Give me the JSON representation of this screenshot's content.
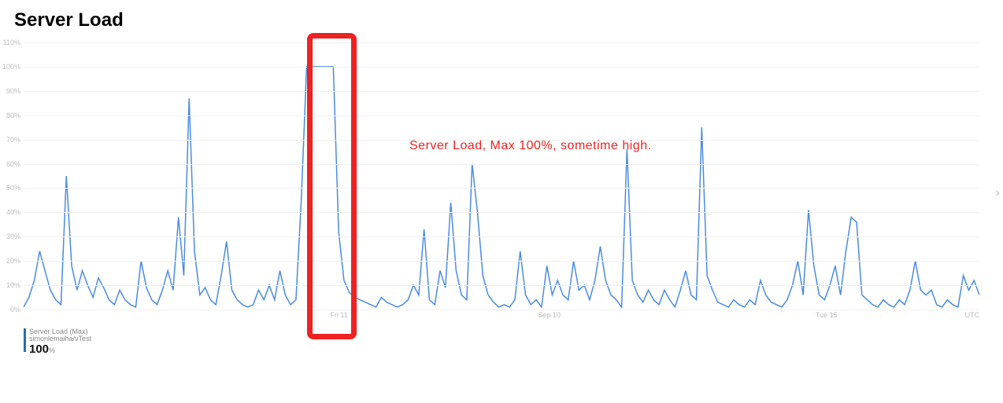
{
  "title": "Server Load",
  "annotation_text": "Server Load,   Max 100%,  sometime high.",
  "x_right_label": "UTC",
  "legend": {
    "line1": "Server Load (Max)",
    "line2": "simonlemaiha/vTest",
    "value": "100",
    "unit": "%"
  },
  "chart_data": {
    "type": "line",
    "title": "Server Load",
    "ylabel": "%",
    "ylim": [
      0,
      110
    ],
    "y_ticks": [
      0,
      10,
      20,
      30,
      40,
      50,
      60,
      70,
      80,
      90,
      100,
      110
    ],
    "x_ticks": [
      {
        "pos": 0.33,
        "label": "Fri 11"
      },
      {
        "pos": 0.55,
        "label": "Sep 10"
      },
      {
        "pos": 0.84,
        "label": "Tue 15"
      }
    ],
    "series": [
      {
        "name": "Server Load (Max)",
        "color": "#4a8bdf",
        "values": [
          1,
          5,
          12,
          24,
          16,
          8,
          4,
          2,
          55,
          18,
          8,
          16,
          10,
          5,
          13,
          9,
          4,
          2,
          8,
          4,
          2,
          1,
          20,
          9,
          4,
          2,
          8,
          16,
          8,
          38,
          14,
          87,
          24,
          6,
          9,
          4,
          2,
          14,
          28,
          8,
          4,
          2,
          1,
          2,
          8,
          4,
          10,
          4,
          16,
          6,
          2,
          4,
          45,
          100,
          100,
          100,
          100,
          100,
          100,
          32,
          12,
          7,
          5,
          4,
          3,
          2,
          1,
          5,
          3,
          2,
          1,
          2,
          4,
          10,
          6,
          33,
          4,
          2,
          16,
          9,
          44,
          16,
          6,
          4,
          60,
          40,
          14,
          6,
          3,
          1,
          2,
          1,
          4,
          24,
          6,
          2,
          4,
          1,
          18,
          6,
          12,
          6,
          4,
          20,
          8,
          10,
          4,
          12,
          26,
          12,
          6,
          4,
          1,
          66,
          12,
          6,
          3,
          8,
          4,
          2,
          8,
          4,
          1,
          8,
          16,
          6,
          4,
          75,
          14,
          8,
          3,
          2,
          1,
          4,
          2,
          1,
          4,
          2,
          12,
          6,
          3,
          2,
          1,
          4,
          10,
          20,
          6,
          41,
          18,
          6,
          4,
          10,
          18,
          6,
          24,
          38,
          36,
          6,
          4,
          2,
          1,
          4,
          2,
          1,
          4,
          2,
          8,
          20,
          8,
          6,
          8,
          2,
          1,
          4,
          2,
          1,
          14,
          8,
          12,
          6
        ]
      }
    ],
    "highlight_region": {
      "x_start_pct": 30.0,
      "x_end_pct": 34.5
    },
    "max_value": 100
  }
}
